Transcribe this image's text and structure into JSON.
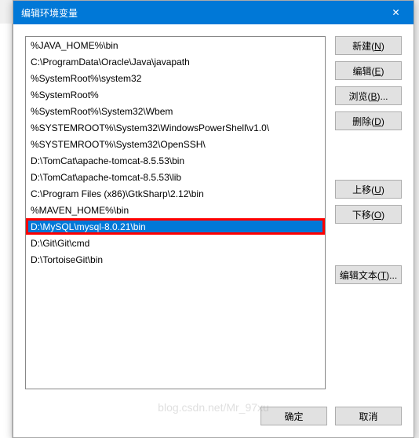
{
  "title": "编辑环境变量",
  "items": [
    "%JAVA_HOME%\\bin",
    "C:\\ProgramData\\Oracle\\Java\\javapath",
    "%SystemRoot%\\system32",
    "%SystemRoot%",
    "%SystemRoot%\\System32\\Wbem",
    "%SYSTEMROOT%\\System32\\WindowsPowerShell\\v1.0\\",
    "%SYSTEMROOT%\\System32\\OpenSSH\\",
    "D:\\TomCat\\apache-tomcat-8.5.53\\bin",
    "D:\\TomCat\\apache-tomcat-8.5.53\\lib",
    "C:\\Program Files (x86)\\GtkSharp\\2.12\\bin",
    "%MAVEN_HOME%\\bin",
    "D:\\MySQL\\mysql-8.0.21\\bin",
    "D:\\Git\\Git\\cmd",
    "D:\\TortoiseGit\\bin"
  ],
  "selectedIndex": 11,
  "highlightedIndex": 11,
  "buttons": {
    "new": {
      "label": "新建(",
      "key": "N",
      "suffix": ")"
    },
    "edit": {
      "label": "编辑(",
      "key": "E",
      "suffix": ")"
    },
    "browse": {
      "label": "浏览(",
      "key": "B",
      "suffix": ")..."
    },
    "delete": {
      "label": "删除(",
      "key": "D",
      "suffix": ")"
    },
    "up": {
      "label": "上移(",
      "key": "U",
      "suffix": ")"
    },
    "down": {
      "label": "下移(",
      "key": "O",
      "suffix": ")"
    },
    "editText": {
      "label": "编辑文本(",
      "key": "T",
      "suffix": ")..."
    },
    "ok": "确定",
    "cancel": "取消"
  },
  "watermark": "blog.csdn.net/Mr_97xu"
}
